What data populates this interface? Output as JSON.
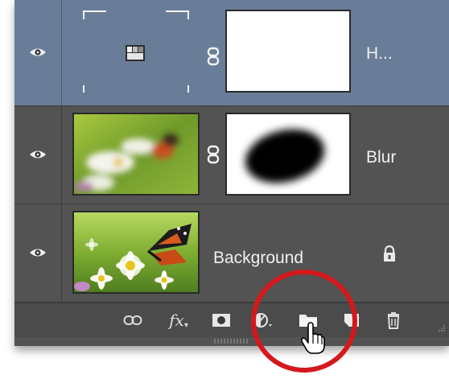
{
  "layers": [
    {
      "name": "H...",
      "type": "adjustment",
      "selected": true
    },
    {
      "name": "Blur",
      "type": "image-with-mask",
      "selected": false
    },
    {
      "name": "Background",
      "type": "background",
      "selected": false,
      "locked": true
    }
  ],
  "toolbar": {
    "fx_label": "fx",
    "buttons": [
      "link-layers",
      "add-layer-style",
      "add-layer-mask",
      "new-fill-adjustment-layer",
      "new-group",
      "new-layer",
      "delete-layer"
    ],
    "highlighted": "new-group"
  },
  "colors": {
    "panel": "#535353",
    "selected_row": "#6a7d98",
    "annotation_circle": "#d4191c"
  }
}
